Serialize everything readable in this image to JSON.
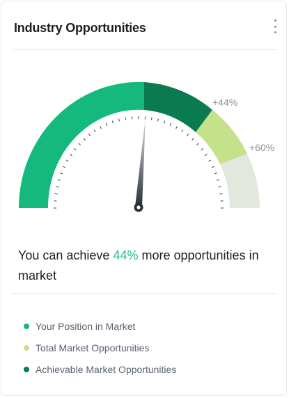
{
  "card": {
    "title": "Industry Opportunities",
    "menu_icon": "more-vertical-icon"
  },
  "gauge": {
    "label_44": "+44%",
    "label_60": "+60%",
    "needle_value_fraction": 0.48,
    "colors": {
      "position": "#15b97d",
      "achievable": "#0a7a51",
      "total": "#c3e28a",
      "remaining": "#e3e8df",
      "needle": "#2a2f38"
    }
  },
  "summary": {
    "prefix": "You can achieve ",
    "highlight": "44%",
    "suffix": " more opportunities in market",
    "highlight_color": "#1fbf80"
  },
  "legend": [
    {
      "label": "Your Position in Market",
      "color": "#15b97d"
    },
    {
      "label": "Total Market Opportunities",
      "color": "#c3e28a"
    },
    {
      "label": "Achievable Market Opportunities",
      "color": "#0a7a51"
    }
  ]
}
